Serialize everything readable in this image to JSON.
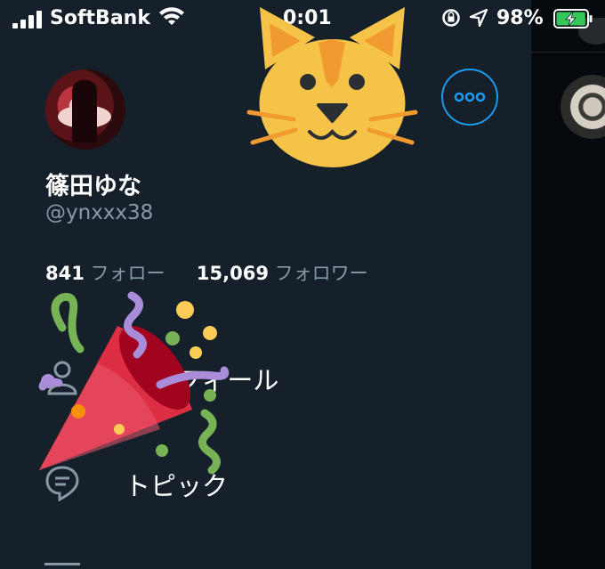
{
  "status_bar": {
    "carrier": "SoftBank",
    "time": "0:01",
    "battery_percent": "98%",
    "battery_level": 0.98,
    "icons": [
      "signal-icon",
      "wifi-icon",
      "rotation-lock-icon",
      "location-arrow-icon",
      "battery-charging-icon"
    ]
  },
  "profile": {
    "display_name": "篠田ゆな",
    "handle": "@ynxxx38",
    "following_count": "841",
    "following_label": "フォロー",
    "followers_count": "15,069",
    "followers_label": "フォロワー"
  },
  "menu": {
    "items": [
      {
        "label": "プロフィール",
        "icon": "person-icon"
      },
      {
        "label": "トピック",
        "icon": "topic-bubble-icon"
      }
    ]
  },
  "colors": {
    "background": "#15202b",
    "accent": "#1d9bf0",
    "text_primary": "#ffffff",
    "text_secondary": "#8899a6"
  },
  "overlays": [
    "cat-face-emoji",
    "party-popper-emoji"
  ]
}
